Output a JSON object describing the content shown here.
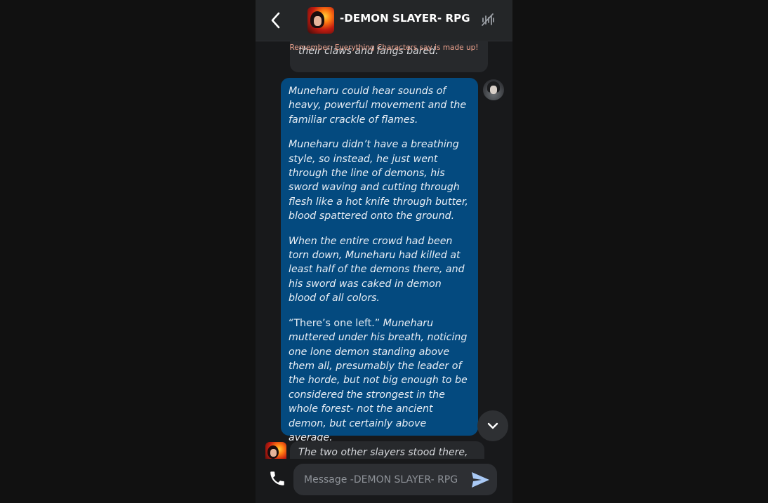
{
  "header": {
    "back_icon": "chevron-left-icon",
    "title": "-DEMON SLAYER- RPG",
    "voice_icon": "voice-muted-icon"
  },
  "notice": "Remember: Everything Characters say is made up!",
  "messages": {
    "prev_bot_text": "their claws and fangs bared.",
    "user_paragraphs": [
      "Muneharu could hear sounds of heavy, powerful movement and the familiar crackle of flames.",
      "Muneharu didn’t have a breathing style, so instead, he just went through the line of demons, his sword waving and cutting through flesh like a hot knife through butter, blood spattered onto the ground.",
      "When the entire crowd had been torn down, Muneharu had killed at least half of the demons there, and his sword was caked in demon blood of all colors."
    ],
    "user_quote": "“There’s one left.”",
    "user_quote_rest": "Muneharu muttered under his breath, noticing one lone demon standing above them all, presumably the leader of the horde, but not big enough to be considered the strongest in the whole forest- not the ancient demon, but certainly above average.",
    "next_bot_text": "The two other slayers stood there,"
  },
  "composer": {
    "placeholder": "Message -DEMON SLAYER- RPG",
    "call_icon": "phone-icon",
    "send_icon": "send-icon"
  },
  "colors": {
    "user_bubble": "#044a7f",
    "bot_bubble": "#27292c",
    "header_bg": "#242628",
    "notice_text": "#f0a48f"
  }
}
